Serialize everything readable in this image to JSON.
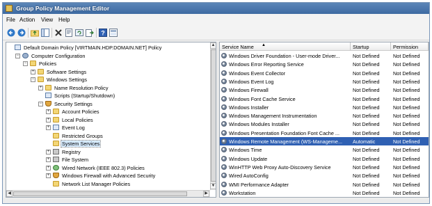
{
  "window": {
    "title": "Group Policy Management Editor"
  },
  "menu": [
    "File",
    "Action",
    "View",
    "Help"
  ],
  "toolbar": [
    "back-icon",
    "forward-icon",
    "up-folder-icon",
    "show-hide-tree-icon",
    "delete-icon",
    "properties-icon",
    "refresh-icon",
    "export-list-icon",
    "help-icon",
    "console-tree-icon"
  ],
  "tree": [
    {
      "label": "Default Domain Policy [VIRTMAIN.HDP.DOMAIN.NET] Policy",
      "icon": "doc",
      "expander": "",
      "indent": 0
    },
    {
      "label": "Computer Configuration",
      "icon": "gear",
      "expander": "−",
      "indent": 1
    },
    {
      "label": "Policies",
      "icon": "folder",
      "expander": "−",
      "indent": 2
    },
    {
      "label": "Software Settings",
      "icon": "folder",
      "expander": "+",
      "indent": 3
    },
    {
      "label": "Windows Settings",
      "icon": "folder",
      "expander": "−",
      "indent": 3
    },
    {
      "label": "Name Resolution Policy",
      "icon": "folder",
      "expander": "+",
      "indent": 4
    },
    {
      "label": "Scripts (Startup/Shutdown)",
      "icon": "doc",
      "expander": "",
      "indent": 4
    },
    {
      "label": "Security Settings",
      "icon": "shield",
      "expander": "−",
      "indent": 4
    },
    {
      "label": "Account Policies",
      "icon": "folder",
      "expander": "+",
      "indent": 5
    },
    {
      "label": "Local Policies",
      "icon": "folder",
      "expander": "+",
      "indent": 5
    },
    {
      "label": "Event Log",
      "icon": "doc",
      "expander": "+",
      "indent": 5
    },
    {
      "label": "Restricted Groups",
      "icon": "folder",
      "expander": "",
      "indent": 5
    },
    {
      "label": "System Services",
      "icon": "folder",
      "expander": "",
      "indent": 5,
      "selected": true
    },
    {
      "label": "Registry",
      "icon": "lock",
      "expander": "+",
      "indent": 5
    },
    {
      "label": "File System",
      "icon": "lock",
      "expander": "+",
      "indent": 5
    },
    {
      "label": "Wired Network (IEEE 802.3) Policies",
      "icon": "net",
      "expander": "+",
      "indent": 5
    },
    {
      "label": "Windows Firewall with Advanced Security",
      "icon": "shield",
      "expander": "+",
      "indent": 5
    },
    {
      "label": "Network List Manager Policies",
      "icon": "folder",
      "expander": "",
      "indent": 5
    }
  ],
  "list": {
    "columns": [
      "Service Name",
      "Startup",
      "Permission"
    ],
    "rows": [
      {
        "name": "Windows Driver Foundation - User-mode Driver...",
        "startup": "Not Defined",
        "permission": "Not Defined"
      },
      {
        "name": "Windows Error Reporting Service",
        "startup": "Not Defined",
        "permission": "Not Defined"
      },
      {
        "name": "Windows Event Collector",
        "startup": "Not Defined",
        "permission": "Not Defined"
      },
      {
        "name": "Windows Event Log",
        "startup": "Not Defined",
        "permission": "Not Defined"
      },
      {
        "name": "Windows Firewall",
        "startup": "Not Defined",
        "permission": "Not Defined"
      },
      {
        "name": "Windows Font Cache Service",
        "startup": "Not Defined",
        "permission": "Not Defined"
      },
      {
        "name": "Windows Installer",
        "startup": "Not Defined",
        "permission": "Not Defined"
      },
      {
        "name": "Windows Management Instrumentation",
        "startup": "Not Defined",
        "permission": "Not Defined"
      },
      {
        "name": "Windows Modules Installer",
        "startup": "Not Defined",
        "permission": "Not Defined"
      },
      {
        "name": "Windows Presentation Foundation Font Cache ...",
        "startup": "Not Defined",
        "permission": "Not Defined"
      },
      {
        "name": "Windows Remote Management (WS-Manageme...",
        "startup": "Automatic",
        "permission": "Not Defined",
        "selected": true
      },
      {
        "name": "Windows Time",
        "startup": "Not Defined",
        "permission": "Not Defined"
      },
      {
        "name": "Windows Update",
        "startup": "Not Defined",
        "permission": "Not Defined"
      },
      {
        "name": "WinHTTP Web Proxy Auto-Discovery Service",
        "startup": "Not Defined",
        "permission": "Not Defined"
      },
      {
        "name": "Wired AutoConfig",
        "startup": "Not Defined",
        "permission": "Not Defined"
      },
      {
        "name": "WMI Performance Adapter",
        "startup": "Not Defined",
        "permission": "Not Defined"
      },
      {
        "name": "Workstation",
        "startup": "Not Defined",
        "permission": "Not Defined"
      }
    ]
  },
  "colors": {
    "titlebar": "#3d6aa2",
    "selection": "#2f60b3"
  }
}
